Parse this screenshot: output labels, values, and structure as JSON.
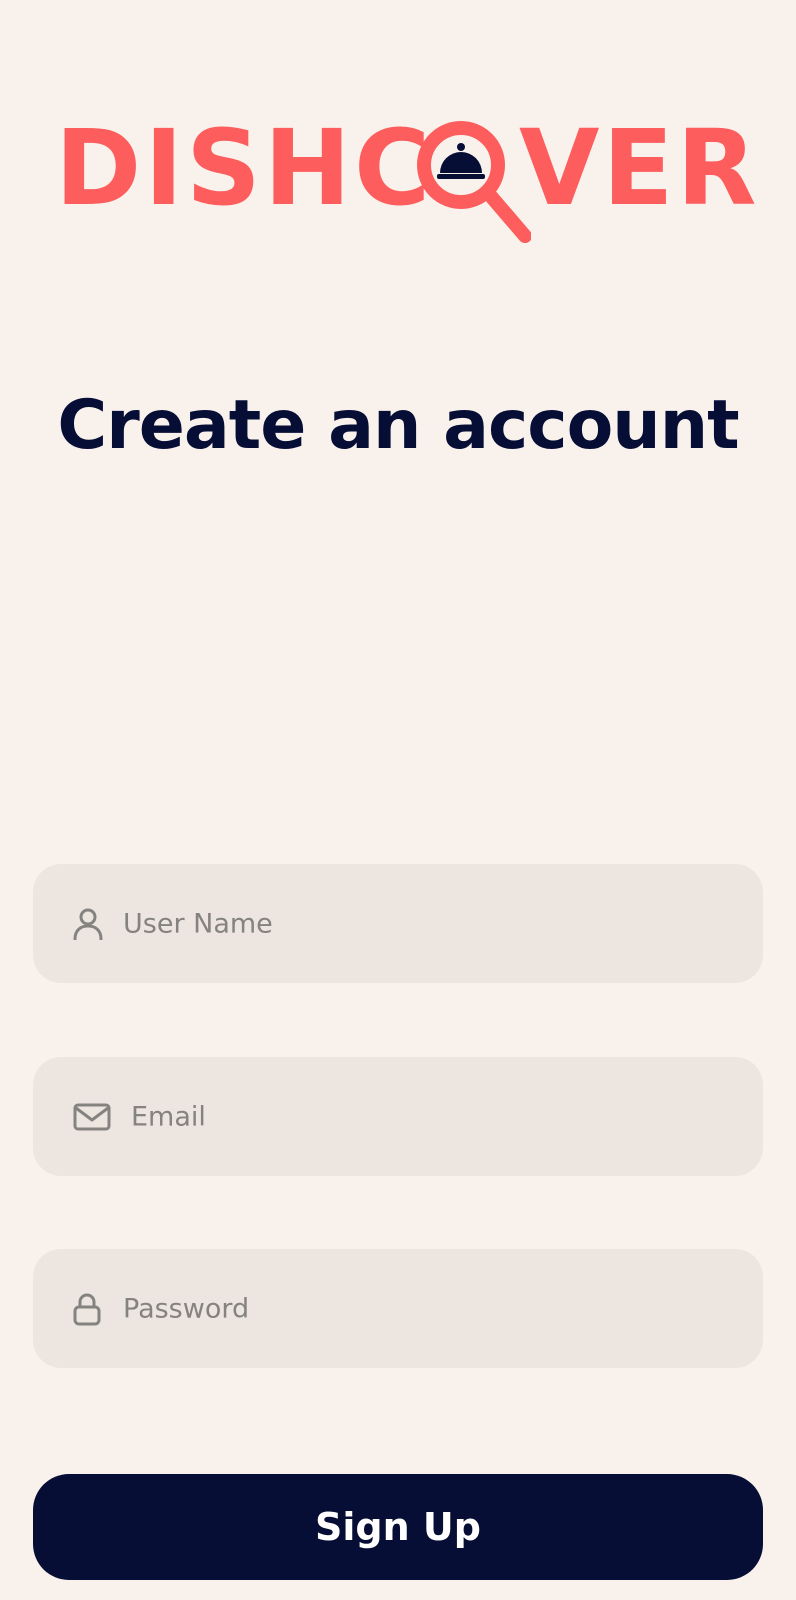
{
  "brand": {
    "name_left": "DISHC",
    "name_right": "VER",
    "color": "#fd5d5d",
    "accent": "#070e35"
  },
  "page": {
    "title": "Create an account"
  },
  "form": {
    "username": {
      "placeholder": "User Name",
      "icon": "user-icon"
    },
    "email": {
      "placeholder": "Email",
      "icon": "mail-icon"
    },
    "password": {
      "placeholder": "Password",
      "icon": "lock-icon"
    }
  },
  "actions": {
    "signup_label": "Sign Up"
  },
  "colors": {
    "background": "#f9f2ec",
    "field_background": "#ede5df",
    "placeholder": "#858380",
    "title": "#070e35",
    "button": "#070e35"
  }
}
